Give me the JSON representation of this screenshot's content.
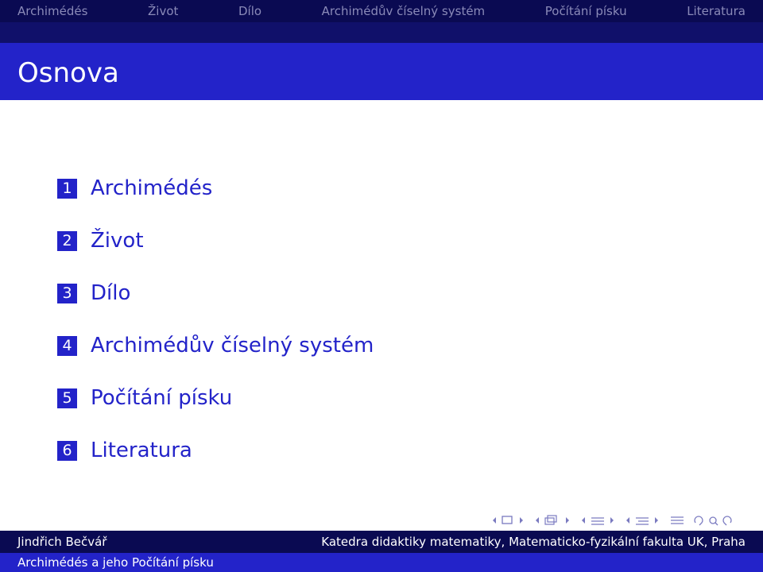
{
  "nav": {
    "sections": [
      "Archimédés",
      "Život",
      "Dílo",
      "Archimédův číselný systém",
      "Počítání písku",
      "Literatura"
    ]
  },
  "slide": {
    "title": "Osnova"
  },
  "toc": {
    "items": [
      {
        "number": "1",
        "label": "Archimédés"
      },
      {
        "number": "2",
        "label": "Život"
      },
      {
        "number": "3",
        "label": "Dílo"
      },
      {
        "number": "4",
        "label": "Archimédův číselný systém"
      },
      {
        "number": "5",
        "label": "Počítání písku"
      },
      {
        "number": "6",
        "label": "Literatura"
      }
    ]
  },
  "footer": {
    "author": "Jindřich Bečvář",
    "institute": "Katedra didaktiky matematiky,  Matematicko-fyzikální fakulta UK, Praha",
    "short_title": "Archimédés a jeho Počítání písku"
  },
  "navigation_symbols": [
    "frame-nav-icon",
    "subsection-nav-icon",
    "section-nav-icon",
    "subsection-icon",
    "appendix-icon",
    "search-icon"
  ],
  "colors": {
    "dark_bar": "#0a0a52",
    "accent": "#2323c9",
    "nav_inactive": "#8a8ab8"
  }
}
